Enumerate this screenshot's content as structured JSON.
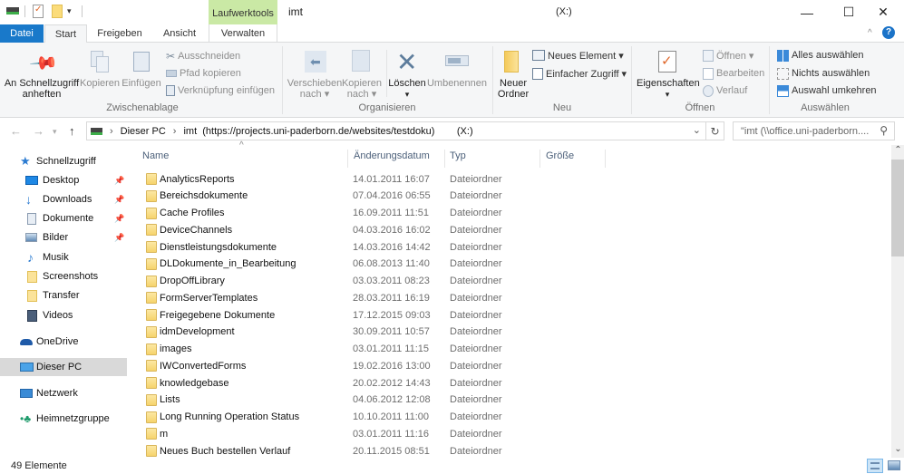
{
  "window": {
    "title": "imt",
    "drive_label": "(X:)",
    "context_tab_group": "Laufwerktools",
    "controls": {
      "minimize": "—",
      "maximize": "☐",
      "close": "✕"
    }
  },
  "quick_access_toolbar": {
    "icons": [
      "drive-icon",
      "properties-icon",
      "new-folder-icon",
      "customize-dropdown-icon"
    ]
  },
  "ribbon_tabs": [
    {
      "label": "Datei",
      "active": false
    },
    {
      "label": "Start",
      "active": true
    },
    {
      "label": "Freigeben",
      "active": false
    },
    {
      "label": "Ansicht",
      "active": false
    },
    {
      "label": "Verwalten",
      "active": false
    }
  ],
  "ribbon": {
    "zwischenablage": {
      "group_label": "Zwischenablage",
      "pin_label_1": "An Schnellzugriff",
      "pin_label_2": "anheften",
      "copy_label": "Kopieren",
      "paste_label": "Einfügen",
      "cut_label": "Ausschneiden",
      "copy_path_label": "Pfad kopieren",
      "paste_shortcut_label": "Verknüpfung einfügen"
    },
    "organisieren": {
      "group_label": "Organisieren",
      "move_label_1": "Verschieben",
      "move_label_2": "nach ▾",
      "copyto_label_1": "Kopieren",
      "copyto_label_2": "nach ▾",
      "delete_label": "Löschen",
      "delete_arrow": "▾",
      "rename_label": "Umbenennen"
    },
    "neu": {
      "group_label": "Neu",
      "new_folder_label_1": "Neuer",
      "new_folder_label_2": "Ordner",
      "new_item_label": "Neues Element ▾",
      "easy_access_label": "Einfacher Zugriff ▾"
    },
    "oeffnen": {
      "group_label": "Öffnen",
      "properties_label": "Eigenschaften",
      "properties_arrow": "▾",
      "open_label": "Öffnen ▾",
      "edit_label": "Bearbeiten",
      "history_label": "Verlauf"
    },
    "auswaehlen": {
      "group_label": "Auswählen",
      "select_all_label": "Alles auswählen",
      "select_none_label": "Nichts auswählen",
      "invert_label": "Auswahl umkehren"
    },
    "collapse_icon": "^",
    "help_icon": "?"
  },
  "address_bar": {
    "back": "←",
    "forward": "→",
    "recent": "▾",
    "up": "↑",
    "breadcrumb": [
      "Dieser PC",
      "imt  (https://projects.uni-paderborn.de/websites/testdoku)        (X:)"
    ],
    "separator": "›",
    "dropdown": "⌄",
    "refresh": "↻"
  },
  "search": {
    "placeholder": "\"imt (\\\\office.uni-paderborn....",
    "icon": "⚲"
  },
  "navigation_pane": {
    "quick_access": "Schnellzugriff",
    "pinned": [
      {
        "label": "Desktop",
        "pinned": true
      },
      {
        "label": "Downloads",
        "pinned": true
      },
      {
        "label": "Dokumente",
        "pinned": true
      },
      {
        "label": "Bilder",
        "pinned": true
      },
      {
        "label": "Musik",
        "pinned": false
      },
      {
        "label": "Screenshots",
        "pinned": false
      },
      {
        "label": "Transfer",
        "pinned": false
      },
      {
        "label": "Videos",
        "pinned": false
      }
    ],
    "onedrive": "OneDrive",
    "this_pc": "Dieser PC",
    "network": "Netzwerk",
    "homegroup": "Heimnetzgruppe"
  },
  "file_list": {
    "sort_indicator": "^",
    "columns": [
      "Name",
      "Änderungsdatum",
      "Typ",
      "Größe"
    ],
    "rows": [
      {
        "name": "AnalyticsReports",
        "date": "14.01.2011 16:07",
        "type": "Dateiordner"
      },
      {
        "name": "Bereichsdokumente",
        "date": "07.04.2016 06:55",
        "type": "Dateiordner"
      },
      {
        "name": "Cache Profiles",
        "date": "16.09.2011 11:51",
        "type": "Dateiordner"
      },
      {
        "name": "DeviceChannels",
        "date": "04.03.2016 16:02",
        "type": "Dateiordner"
      },
      {
        "name": "Dienstleistungsdokumente",
        "date": "14.03.2016 14:42",
        "type": "Dateiordner"
      },
      {
        "name": "DLDokumente_in_Bearbeitung",
        "date": "06.08.2013 11:40",
        "type": "Dateiordner"
      },
      {
        "name": "DropOffLibrary",
        "date": "03.03.2011 08:23",
        "type": "Dateiordner"
      },
      {
        "name": "FormServerTemplates",
        "date": "28.03.2011 16:19",
        "type": "Dateiordner"
      },
      {
        "name": "Freigegebene Dokumente",
        "date": "17.12.2015 09:03",
        "type": "Dateiordner"
      },
      {
        "name": "idmDevelopment",
        "date": "30.09.2011 10:57",
        "type": "Dateiordner"
      },
      {
        "name": "images",
        "date": "03.01.2011 11:15",
        "type": "Dateiordner"
      },
      {
        "name": "IWConvertedForms",
        "date": "19.02.2016 13:00",
        "type": "Dateiordner"
      },
      {
        "name": "knowledgebase",
        "date": "20.02.2012 14:43",
        "type": "Dateiordner"
      },
      {
        "name": "Lists",
        "date": "04.06.2012 12:08",
        "type": "Dateiordner"
      },
      {
        "name": "Long Running Operation Status",
        "date": "10.10.2011 11:00",
        "type": "Dateiordner"
      },
      {
        "name": "m",
        "date": "03.01.2011 11:16",
        "type": "Dateiordner"
      },
      {
        "name": "Neues Buch bestellen Verlauf",
        "date": "20.11.2015 08:51",
        "type": "Dateiordner"
      }
    ]
  },
  "scrollbar": {
    "up": "⌃",
    "down": "⌄",
    "position_fraction": 0.0
  },
  "status_bar": {
    "item_count": "49 Elemente",
    "view_details": "details-view-icon",
    "view_large": "large-icons-view-icon"
  }
}
